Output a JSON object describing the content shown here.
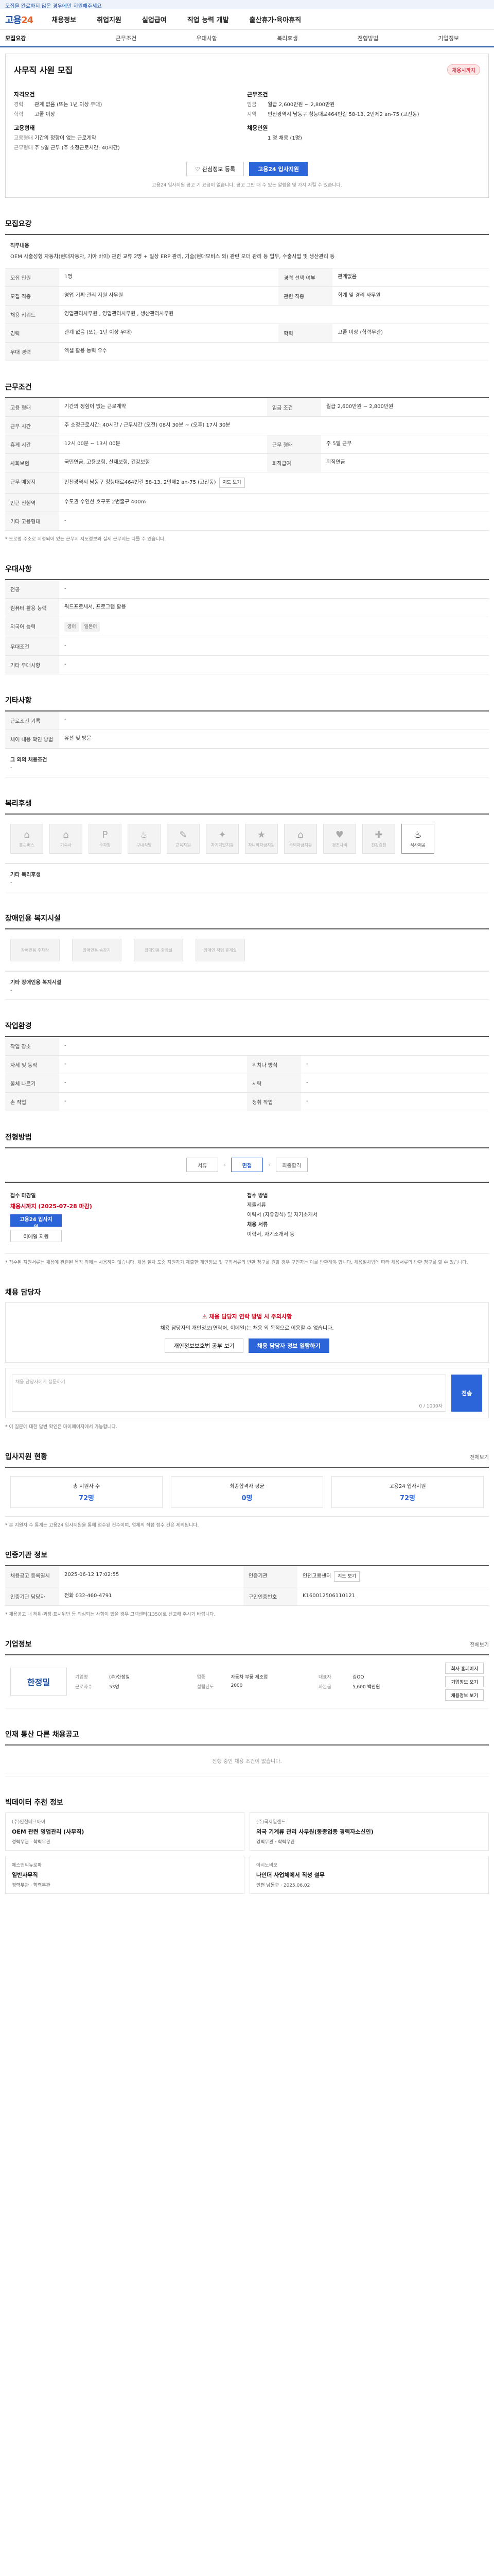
{
  "notice": "모집을 완료하지 않은 경우에만 지원해주세요",
  "brand": {
    "name": "고용",
    "num": "24"
  },
  "topnav": [
    "채용정보",
    "취업지원",
    "실업급여",
    "직업 능력 개발",
    "출산휴가·육아휴직"
  ],
  "subnav": [
    "모집요강",
    "근무조건",
    "우대사항",
    "복리후생",
    "전형방법",
    "기업정보"
  ],
  "job": {
    "title": "사무직 사원 모집",
    "badge": "채용시까지",
    "left": [
      {
        "section": "자격요건",
        "rows": [
          {
            "k": "경력",
            "v": "관계 없음 (또는 1년 이상 우대)"
          },
          {
            "k": "학력",
            "v": "고졸 이상"
          }
        ]
      },
      {
        "section": "고용형태",
        "rows": [
          {
            "k": "고용형태",
            "v": "기간의 정함이 없는 근로계약"
          },
          {
            "k": "근무형태",
            "v": "주 5일 근무 (주 소정근로시간: 40시간)"
          }
        ]
      }
    ],
    "right": [
      {
        "section": "근무조건",
        "rows": [
          {
            "k": "임금",
            "v": "월급 2,600만원 ~ 2,800만원"
          },
          {
            "k": "지역",
            "v": "인천광역시 남동구 청능대로464번길 58-13, 2만제2 an-75 (고잔동)"
          }
        ]
      },
      {
        "section": "채용인원",
        "rows": [
          {
            "k": "",
            "v": "1 명 채용 (1명)"
          }
        ]
      }
    ],
    "scrap_label": "관심정보 등록",
    "apply_label": "고용24 입사지원",
    "note": "고용24 입사지원 공고 기 요금이 없습니다. 공고 그만 때 수 있는 알림을 몇 가지 지킬 수 있습니다."
  },
  "recruit": {
    "title": "모집요강",
    "desc_head": "직무내용",
    "desc_text": "OEM 사출성형 자동차(현대자동차, 기아 바이) 관련 교류 2명 + 일상 ERP 관리, 기술(현대모비스 외) 관련 오더 관리 등 업무, 수출사업 및 생산관리 등",
    "rows": [
      {
        "k": "모집 인원",
        "v": "1명",
        "k2": "경력 선택 여부",
        "v2": "관계없음"
      },
      {
        "k": "모집 직종",
        "v": "영업 기획·관리 지원 사무원",
        "k2": "관련 직종",
        "v2": "회계 및 경리 사무원"
      },
      {
        "k": "채용 키워드",
        "v": "영업관리사무원 , 영업관리사무원 , 생산관리사무원"
      },
      {
        "k": "경력",
        "v": "관계 없음 (또는 1년 이상 우대)",
        "k2": "학력",
        "v2": "고졸 이상 (학력무관)"
      },
      {
        "k": "우대 경력",
        "v": "엑셀 활용 능력 우수"
      }
    ]
  },
  "conditions": {
    "title": "근무조건",
    "rows": [
      {
        "k": "고용 형태",
        "v": "기간의 정함이 없는 근로계약",
        "k2": "임금 조건",
        "v2": "월급 2,600만원 ~ 2,800만원"
      },
      {
        "k": "근무 시간",
        "v": "주 소정근로시간: 40시간 / 근무시간 (오전) 08시 30분 ~ (오후) 17시 30분"
      },
      {
        "k": "휴게 시간",
        "v": "12시 00분 ~ 13시 00분",
        "k2": "근무 형태",
        "v2": "주 5일 근무"
      },
      {
        "k": "사회보험",
        "v": "국민연금, 고용보험, 산재보험, 건강보험",
        "k2": "퇴직급여",
        "v2": "퇴직연금"
      },
      {
        "k": "근무 예정지",
        "v": "인천광역시 남동구 청능대로464번길 58-13, 2만제2 an-75 (고잔동)",
        "btn": "지도 보기"
      },
      {
        "k": "인근 전철역",
        "v": "수도권 수인선 호구포 2번출구 400m"
      },
      {
        "k": "기타 고용형태",
        "v": "-"
      }
    ],
    "note": "* 도로명 주소로 지정되어 있는 근무지 지도정보와 실제 근무지는 다를 수 있습니다."
  },
  "preference": {
    "title": "우대사항",
    "rows": [
      {
        "k": "전공",
        "v": "-"
      },
      {
        "k": "컴퓨터 활용 능력",
        "v": "워드프로세서, 프로그램 활용"
      },
      {
        "k": "외국어 능력",
        "v": "영어",
        "chips": [
          "영어",
          "일본어"
        ]
      },
      {
        "k": "우대조건",
        "v": "-"
      },
      {
        "k": "기타 우대사항",
        "v": "-"
      }
    ]
  },
  "etc": {
    "title": "기타사항",
    "rows": [
      {
        "k": "근로조건 기록",
        "v": "-"
      },
      {
        "k": "채어 내용 확인 방법",
        "v": "유선 및 방문"
      }
    ],
    "sub_head": "그 외의 채용조건",
    "sub_text": "-"
  },
  "welfare": {
    "title": "복리후생",
    "items": [
      {
        "label": "통근버스",
        "on": false,
        "icon": "⌂"
      },
      {
        "label": "기숙사",
        "on": false,
        "icon": "⌂"
      },
      {
        "label": "주차장",
        "on": false,
        "icon": "P"
      },
      {
        "label": "구내식당",
        "on": false,
        "icon": "♨"
      },
      {
        "label": "교육지원",
        "on": false,
        "icon": "✎"
      },
      {
        "label": "자기계발지원",
        "on": false,
        "icon": "✦"
      },
      {
        "label": "자녀학자금지원",
        "on": false,
        "icon": "★"
      },
      {
        "label": "주택자금지원",
        "on": false,
        "icon": "⌂"
      },
      {
        "label": "경조사비",
        "on": false,
        "icon": "♥"
      },
      {
        "label": "건강검진",
        "on": false,
        "icon": "✚"
      },
      {
        "label": "식사제공",
        "on": true,
        "icon": "♨"
      }
    ],
    "sub_head": "기타 복리후생",
    "sub_text": "-"
  },
  "disability": {
    "title": "장애인용 복지시설",
    "items": [
      "장애인용 주차장",
      "장애인용 승강기",
      "장애인용 화장실",
      "장애인 작업 휴게실"
    ],
    "sub_head": "기타 장애인용 복지시설",
    "sub_text": "-"
  },
  "work_env": {
    "title": "작업환경",
    "rows": [
      {
        "k": "작업 장소",
        "v": "-"
      },
      {
        "k": "자세 및 동작",
        "v": "-",
        "k2": "위치나 방식",
        "v2": "-"
      },
      {
        "k": "물체 나르기",
        "v": "-",
        "k2": "시력",
        "v2": "-"
      },
      {
        "k": "손 작업",
        "v": "-",
        "k2": "청취 작업",
        "v2": "-"
      }
    ]
  },
  "process": {
    "title": "전형방법",
    "steps": [
      {
        "label": "서류",
        "on": false
      },
      {
        "label": "면접",
        "on": true
      },
      {
        "label": "최종합격",
        "on": false
      }
    ],
    "col1_head": "접수 마감일",
    "col1_big": "채용시까지 (2025-07-28 마감)",
    "col1_btn1": "고용24 입사지원",
    "col1_btn2": "이메일 지원",
    "col2_head": "접수 방법",
    "col2_rows": [
      "제출서류",
      "이력서 (자유양식) 및 자기소개서",
      "채용 서류",
      "이력서, 자기소개서 등"
    ],
    "notes": "* 접수된 지원서류는 채용에 관련된 목적 외에는 사용하지 않습니다. 채용 절차 도중 지원자가 제출한 개인정보 및 구직서류의 반환 청구를 원할 경우 구인자는 이를 반환해야 합니다. 채용절차법에 따라 채용서류의 반환 청구를 할 수 있습니다."
  },
  "contact": {
    "title": "채용 담당자",
    "warn_head": "채용 담당자 연락 방법 시 주의사항",
    "warn_text": "채용 담당자의 개인정보(연락처, 이메일)는 채용 외 목적으로 이용할 수 없습니다.",
    "btn1": "개인정보보호법 공부 보기",
    "btn2": "채용 담당자 정보 열람하기",
    "qa_placeholder": "채용 담당자에게 질문하기",
    "qa_count": "0 / 1000자",
    "qa_send": "전송",
    "qa_notes": "* 이 질문에 대한 답변 확인은 마이페이지에서 가능합니다."
  },
  "stats": {
    "title": "입사지원 현황",
    "more": "전체보기",
    "items": [
      {
        "label": "총 지원자 수",
        "value": "72명"
      },
      {
        "label": "최종합격자 평균",
        "value": "0명"
      },
      {
        "label": "고용24 입사지원",
        "value": "72명"
      }
    ],
    "note": "* 본 지원자 수 통계는 고용24 입사지원을 통해 접수된 건수이며, 업체의 직접 접수 건은 제외됩니다."
  },
  "summary": {
    "title": "인증기관 정보",
    "rows": [
      {
        "k": "채용공고 등록일시",
        "v": "2025-06-12 17:02:55",
        "k2": "인증기관",
        "v2": "인천고용센터",
        "btn": "지도 보기"
      },
      {
        "k": "인증기관 담당자",
        "v": "전화 032-460-4791",
        "k2": "구인인증번호",
        "v2": "K160012506110121"
      }
    ],
    "notes": "* 채용공고 내 허위·과장·표시위반 등 의심되는 사항이 있을 경우 고객센터(1350)로 신고해 주시기 바랍니다."
  },
  "company": {
    "title": "기업정보",
    "more": "전체보기",
    "logo": "한정밀",
    "rows": [
      {
        "k": "기업명",
        "v": "(주)한정밀"
      },
      {
        "k": "업종",
        "v": "자동차 부품 제조업"
      },
      {
        "k": "대표자",
        "v": "김OO"
      },
      {
        "k": "근로자수",
        "v": "53명"
      },
      {
        "k": "설립년도",
        "v": "2000"
      },
      {
        "k": "자본금",
        "v": "5,600 백만원"
      }
    ],
    "btn1": "회사 홈페이지",
    "btn2": "기업정보 보기",
    "btn3": "채용정보 보기"
  },
  "other_jobs": {
    "title": "인재 통산 다른 채용공고",
    "empty": "진행 중인 채용 조건이 없습니다."
  },
  "recommend": {
    "title": "빅데이터 추천 정보",
    "cards": [
      {
        "co": "(주)인천테크아이",
        "title": "OEM 관련 영업관리 (사무직)",
        "meta": "경력무관 · 학력무관"
      },
      {
        "co": "(주)국제일랜드",
        "title": "외국 기계류 관리 사무원(동종업종 경력자소신인)",
        "meta": "경력무관 · 학력무관"
      },
      {
        "co": "에스앤씨뉴로파",
        "title": "일반사무직",
        "meta": "경력무관 · 학력무관"
      },
      {
        "co": "아시노비오",
        "title": "나인더 사업체에서 직성 설무",
        "meta": "인천 남동구 · 2025.06.02"
      }
    ]
  }
}
